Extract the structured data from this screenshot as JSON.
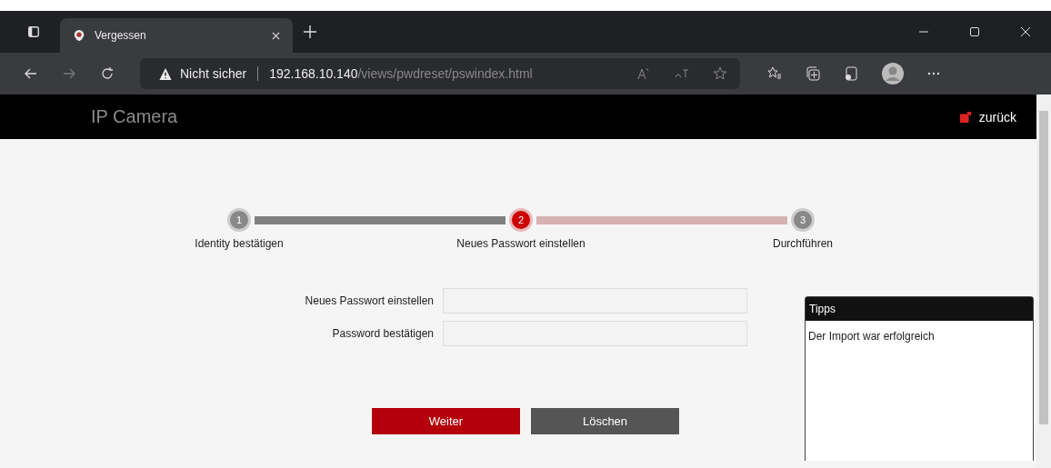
{
  "browser": {
    "tabs": [
      {
        "title": "Vergessen",
        "selected": true
      }
    ],
    "security": "Nicht sicher",
    "url_host": "192.168.10.140",
    "url_path": "/views/pwdreset/pswindex.html"
  },
  "header": {
    "title": "IP Camera",
    "back": "zurück"
  },
  "steps": [
    {
      "number": "1",
      "label": "Identity bestätigen",
      "kind": "done"
    },
    {
      "number": "2",
      "label": "Neues Passwort einstellen",
      "kind": "current"
    },
    {
      "number": "3",
      "label": "Durchführen",
      "kind": "todo"
    }
  ],
  "form": {
    "fields": [
      {
        "label": "Neues Passwort einstellen"
      },
      {
        "label": "Password bestätigen"
      }
    ]
  },
  "buttons": [
    {
      "label": "Weiter",
      "kind": "primary"
    },
    {
      "label": "Löschen",
      "kind": "secondary"
    }
  ],
  "tips": {
    "title": "Tipps",
    "text": "Der Import war erfolgreich"
  }
}
